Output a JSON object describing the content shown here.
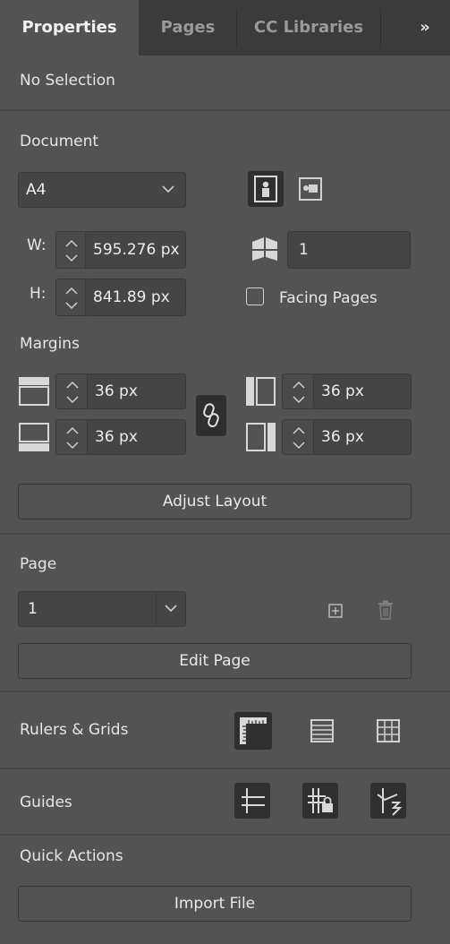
{
  "tabs": [
    {
      "label": "Properties"
    },
    {
      "label": "Pages"
    },
    {
      "label": "CC Libraries"
    }
  ],
  "tabs_overflow": "»",
  "selection_status": "No Selection",
  "document": {
    "heading": "Document",
    "preset": "A4",
    "width_label": "W:",
    "width_value": "595.276 px",
    "height_label": "H:",
    "height_value": "841.89 px",
    "pages_value": "1",
    "facing_pages_label": "Facing Pages",
    "facing_pages_checked": false
  },
  "margins": {
    "heading": "Margins",
    "top": "36 px",
    "bottom": "36 px",
    "left": "36 px",
    "right": "36 px",
    "adjust_layout_label": "Adjust Layout"
  },
  "page": {
    "heading": "Page",
    "value": "1",
    "edit_page_label": "Edit Page"
  },
  "rulers_grids": {
    "heading": "Rulers & Grids"
  },
  "guides": {
    "heading": "Guides"
  },
  "quick_actions": {
    "heading": "Quick Actions",
    "import_file_label": "Import File"
  },
  "colors": {
    "panel_bg": "#535353",
    "tabbar_bg": "#3b3b3b",
    "field_bg": "#454545",
    "icon_dark_bg": "#2f2f2f"
  }
}
